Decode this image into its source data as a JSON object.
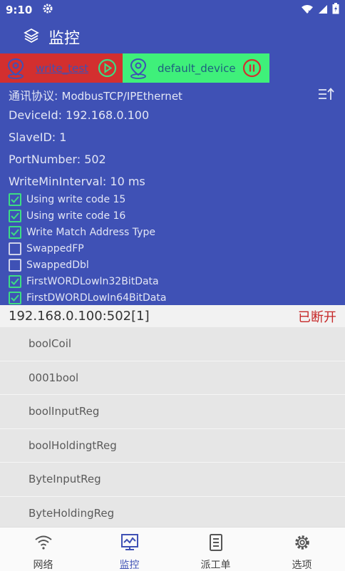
{
  "status": {
    "time": "9:10"
  },
  "app": {
    "title": "监控"
  },
  "devices": [
    {
      "name": "write_test",
      "state": "play"
    },
    {
      "name": "default_device",
      "state": "pause"
    }
  ],
  "params": {
    "protocol_label": "通讯协议:",
    "protocol_value": "ModbusTCP/IPEthernet",
    "device_id": "DeviceId: 192.168.0.100",
    "slave_id": "SlaveID:   1",
    "port_number": "PortNumber:   502",
    "write_min_interval": "WriteMinInterval:   10 ms"
  },
  "options": [
    {
      "label": "Using write code 15",
      "checked": true
    },
    {
      "label": "Using write code 16",
      "checked": true
    },
    {
      "label": "Write Match Address Type",
      "checked": true
    },
    {
      "label": "SwappedFP",
      "checked": false
    },
    {
      "label": "SwappedDbl",
      "checked": false
    },
    {
      "label": "FirstWORDLowIn32BitData",
      "checked": true
    },
    {
      "label": "FirstDWORDLowIn64BitData",
      "checked": true
    }
  ],
  "connection": {
    "address": "192.168.0.100:502[1]",
    "state": "已断开"
  },
  "points": [
    "boolCoil",
    "0001bool",
    "boolInputReg",
    "boolHoldingtReg",
    "ByteInputReg",
    "ByteHoldingReg"
  ],
  "nav": [
    {
      "label": "网络",
      "icon": "wifi-icon"
    },
    {
      "label": "监控",
      "icon": "monitor-icon"
    },
    {
      "label": "派工单",
      "icon": "clipboard-icon"
    },
    {
      "label": "选项",
      "icon": "gear-icon"
    }
  ],
  "colors": {
    "primary": "#3f51b5",
    "device1_bg": "#d32f2f",
    "device2_bg": "#3ff07a",
    "check_green": "#3ddc84",
    "disconnected": "#c62828"
  }
}
